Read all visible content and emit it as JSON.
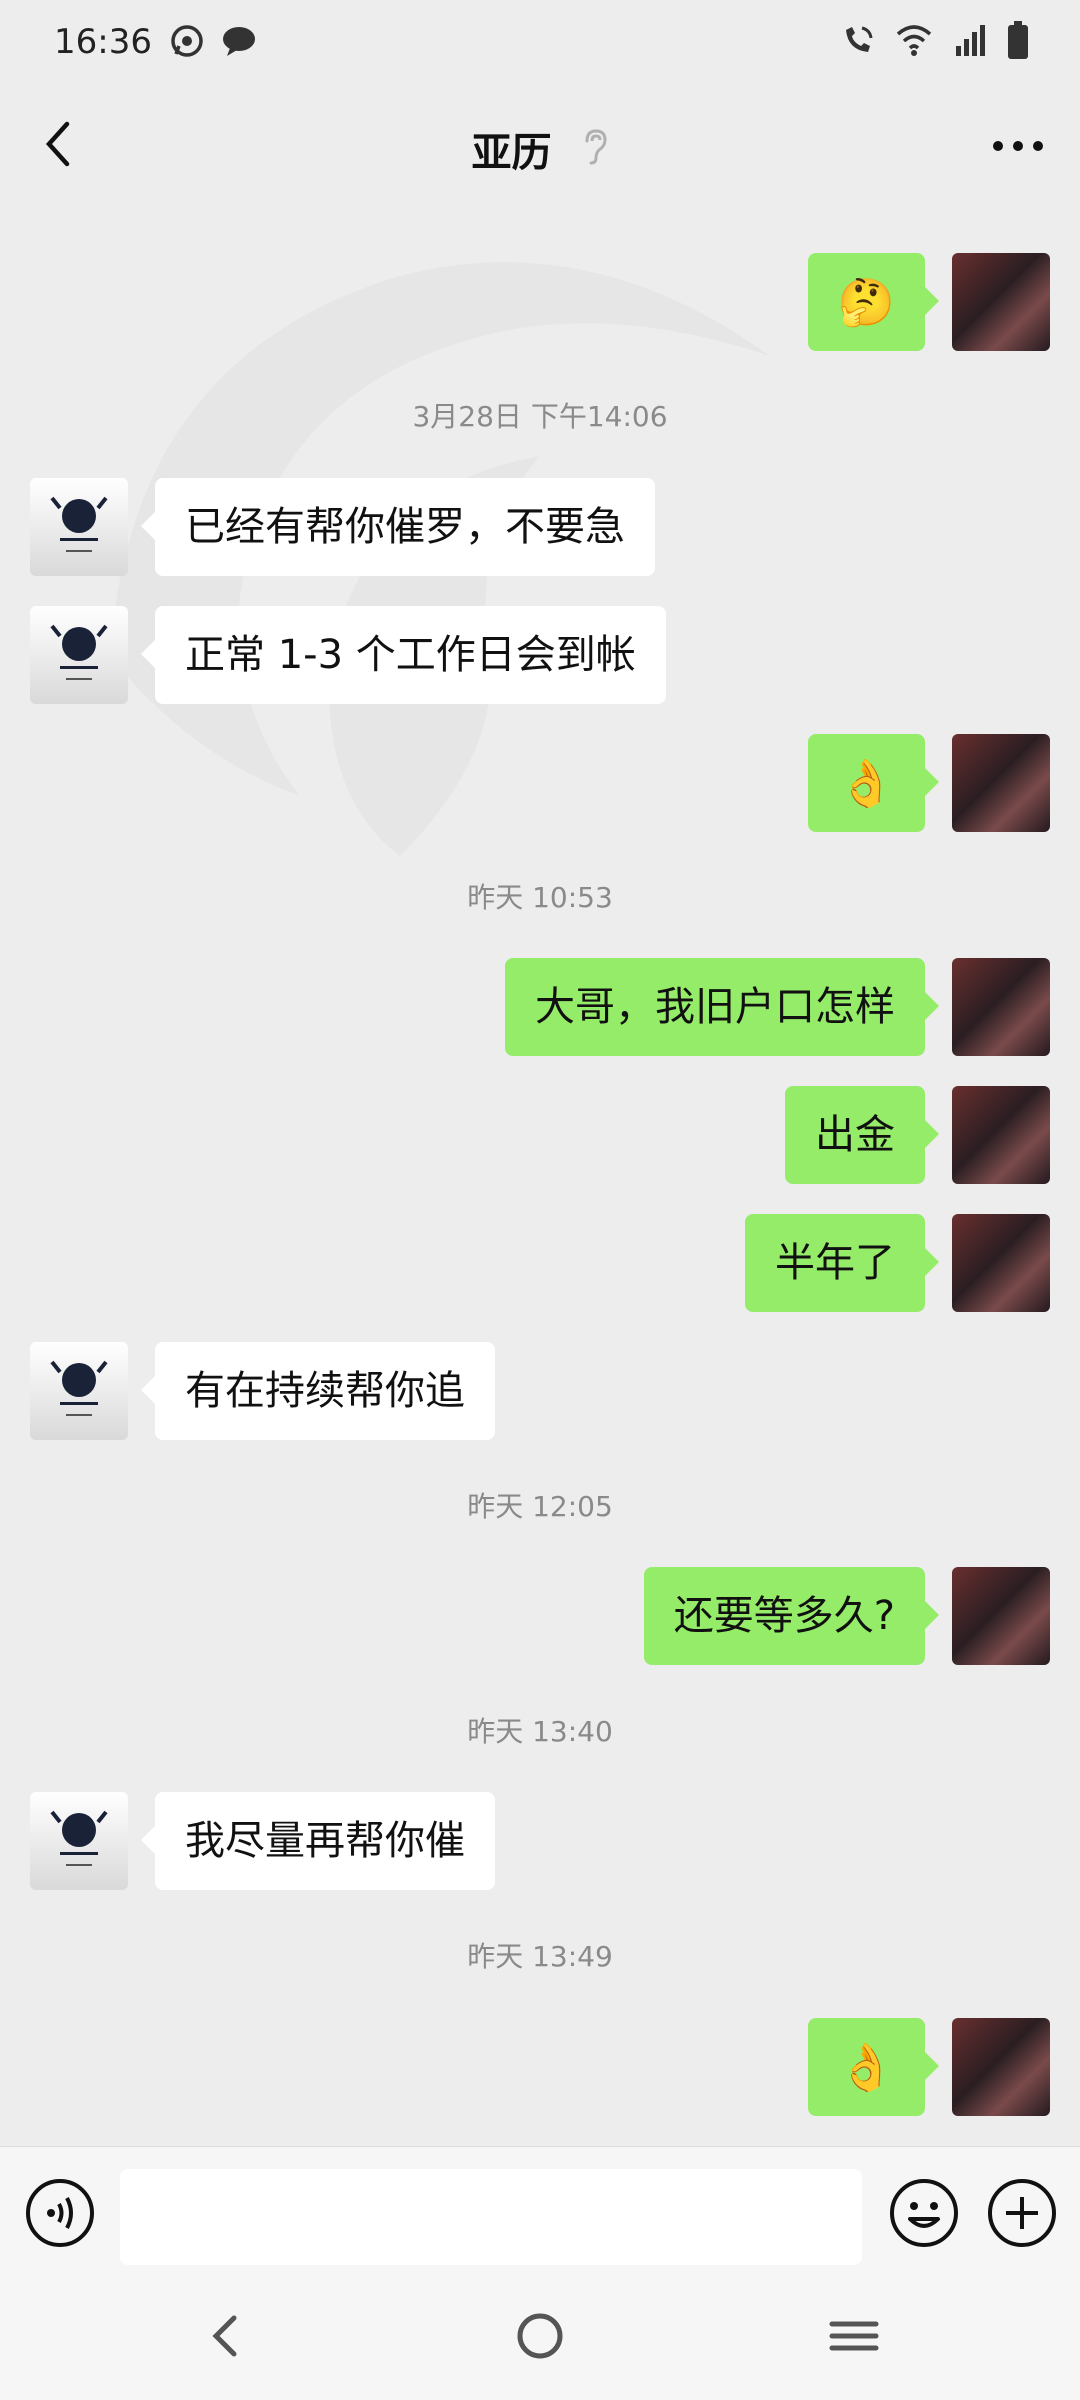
{
  "status_bar": {
    "time": "16:36",
    "icons": [
      "whatsapp-icon",
      "message-icon",
      "wifi-call-icon",
      "wifi-icon",
      "signal-icon",
      "battery-icon"
    ]
  },
  "header": {
    "title": "亚历",
    "back_icon": "chevron-left-icon",
    "ear_icon": "ear-icon",
    "more_icon": "more-dots-icon"
  },
  "messages": [
    {
      "side": "right",
      "type": "emoji",
      "text": "🤔"
    },
    {
      "type": "timestamp",
      "text": "3月28日 下午14:06"
    },
    {
      "side": "left",
      "type": "text",
      "text": "已经有帮你催罗，不要急"
    },
    {
      "side": "left",
      "type": "text",
      "text": "正常 1-3 个工作日会到帐"
    },
    {
      "side": "right",
      "type": "emoji",
      "text": "👌"
    },
    {
      "type": "timestamp",
      "text": "昨天 10:53"
    },
    {
      "side": "right",
      "type": "text",
      "text": "大哥，我旧户口怎样"
    },
    {
      "side": "right",
      "type": "text",
      "text": "出金"
    },
    {
      "side": "right",
      "type": "text",
      "text": "半年了"
    },
    {
      "side": "left",
      "type": "text",
      "text": "有在持续帮你追"
    },
    {
      "type": "timestamp",
      "text": "昨天 12:05"
    },
    {
      "side": "right",
      "type": "text",
      "text": "还要等多久?"
    },
    {
      "type": "timestamp",
      "text": "昨天 13:40"
    },
    {
      "side": "left",
      "type": "text",
      "text": "我尽量再帮你催"
    },
    {
      "type": "timestamp",
      "text": "昨天 13:49"
    },
    {
      "side": "right",
      "type": "emoji",
      "text": "👌"
    }
  ],
  "input_bar": {
    "value": "",
    "icons": [
      "voice-icon",
      "emoji-icon",
      "plus-icon"
    ]
  },
  "nav_bar": {
    "icons": [
      "nav-back-icon",
      "nav-home-icon",
      "nav-recents-icon"
    ]
  },
  "colors": {
    "background": "#ededed",
    "bubble_self": "#95ec69",
    "bubble_other": "#ffffff",
    "timestamp_text": "#8a8a8a"
  }
}
